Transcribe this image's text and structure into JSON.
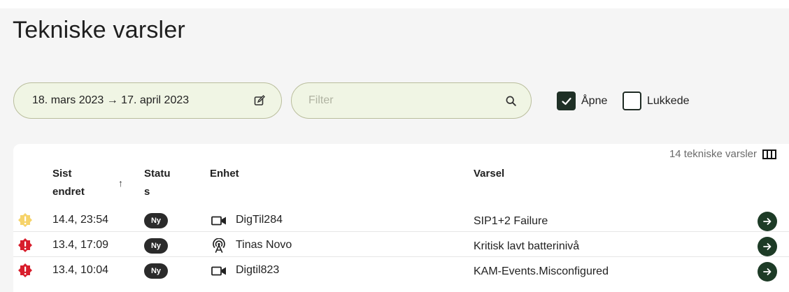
{
  "page": {
    "title": "Tekniske varsler"
  },
  "filters": {
    "date_range": "18. mars 2023 → 17. april 2023",
    "filter_placeholder": "Filter",
    "filter_value": "",
    "open_label": "Åpne",
    "open_checked": true,
    "closed_label": "Lukkede",
    "closed_checked": false
  },
  "table": {
    "count_label": "14 tekniske varsler",
    "headers": {
      "sist_endret": "Sist endret",
      "status": "Status",
      "enhet": "Enhet",
      "varsel": "Varsel"
    },
    "sort_indicator": "↑",
    "rows": [
      {
        "severity": "warning",
        "severity_color": "#f6d36a",
        "time": "14.4, 23:54",
        "status": "Ny",
        "device_icon": "camera-icon",
        "device": "DigTil284",
        "alert": "SIP1+2 Failure"
      },
      {
        "severity": "critical",
        "severity_color": "#d81e2c",
        "time": "13.4, 17:09",
        "status": "Ny",
        "device_icon": "sensor-icon",
        "device": "Tinas Novo",
        "alert": "Kritisk lavt batterinivå"
      },
      {
        "severity": "critical",
        "severity_color": "#d81e2c",
        "time": "13.4, 10:04",
        "status": "Ny",
        "device_icon": "camera-icon",
        "device": "Digtil823",
        "alert": "KAM-Events.Misconfigured"
      }
    ]
  },
  "colors": {
    "pill_bg": "#f0f5e4",
    "accent_dark": "#1d3b26",
    "badge_bg": "#2b2b2b"
  }
}
